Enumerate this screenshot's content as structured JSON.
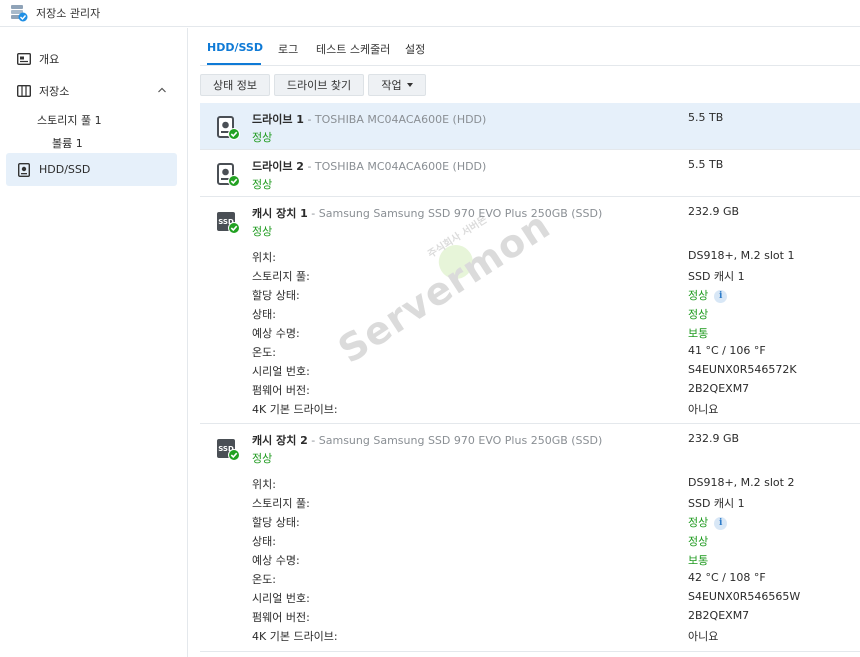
{
  "app": {
    "title": "저장소 관리자"
  },
  "sidebar": {
    "items": [
      {
        "label": "개요",
        "icon": "overview-icon"
      },
      {
        "label": "저장소",
        "icon": "storage-icon"
      },
      {
        "label": "HDD/SSD",
        "icon": "hdd-icon",
        "active": true
      }
    ],
    "sub_items": [
      {
        "label": "스토리지 풀 1"
      },
      {
        "label": "볼륨 1"
      }
    ]
  },
  "tabs": [
    {
      "label": "HDD/SSD",
      "active": true
    },
    {
      "label": "로그"
    },
    {
      "label": "테스트 스케줄러"
    },
    {
      "label": "설정"
    }
  ],
  "toolbar": {
    "status_label": "상태 정보",
    "find_label": "드라이브 찾기",
    "action_label": "작업"
  },
  "drives": [
    {
      "name": "드라이브 1",
      "model": " - TOSHIBA MC04ACA600E (HDD)",
      "status": "정상",
      "size": "5.5 TB",
      "type": "hdd"
    },
    {
      "name": "드라이브 2",
      "model": " - TOSHIBA MC04ACA600E (HDD)",
      "status": "정상",
      "size": "5.5 TB",
      "type": "hdd"
    },
    {
      "name": "캐시 장치 1",
      "model": " - Samsung Samsung SSD 970 EVO Plus 250GB (SSD)",
      "status": "정상",
      "size": "232.9 GB",
      "type": "ssd",
      "details": [
        {
          "label": "위치:",
          "value": "DS918+, M.2 slot 1"
        },
        {
          "label": "스토리지 풀:",
          "value": "SSD 캐시 1"
        },
        {
          "label": "할당 상태:",
          "value": "정상",
          "green": true,
          "info": true
        },
        {
          "label": "상태:",
          "value": "정상",
          "green": true
        },
        {
          "label": "예상 수명:",
          "value": "보통",
          "green": true
        },
        {
          "label": "온도:",
          "value": "41 °C / 106 °F"
        },
        {
          "label": "시리얼 번호:",
          "value": "S4EUNX0R546572K"
        },
        {
          "label": "펌웨어 버전:",
          "value": "2B2QEXM7"
        },
        {
          "label": "4K 기본 드라이브:",
          "value": "아니요"
        }
      ]
    },
    {
      "name": "캐시 장치 2",
      "model": " - Samsung Samsung SSD 970 EVO Plus 250GB (SSD)",
      "status": "정상",
      "size": "232.9 GB",
      "type": "ssd",
      "details": [
        {
          "label": "위치:",
          "value": "DS918+, M.2 slot 2"
        },
        {
          "label": "스토리지 풀:",
          "value": "SSD 캐시 1"
        },
        {
          "label": "할당 상태:",
          "value": "정상",
          "green": true,
          "info": true
        },
        {
          "label": "상태:",
          "value": "정상",
          "green": true
        },
        {
          "label": "예상 수명:",
          "value": "보통",
          "green": true
        },
        {
          "label": "온도:",
          "value": "42 °C / 108 °F"
        },
        {
          "label": "시리얼 번호:",
          "value": "S4EUNX0R546565W"
        },
        {
          "label": "펌웨어 버전:",
          "value": "2B2QEXM7"
        },
        {
          "label": "4K 기본 드라이브:",
          "value": "아니요"
        }
      ]
    }
  ],
  "watermark": {
    "text": "Servermon",
    "sub": "주식회사 서버몬"
  },
  "colors": {
    "accent": "#0f7ad6",
    "ok_green": "#1e9a1e",
    "selected_bg": "#e6f0fa"
  }
}
